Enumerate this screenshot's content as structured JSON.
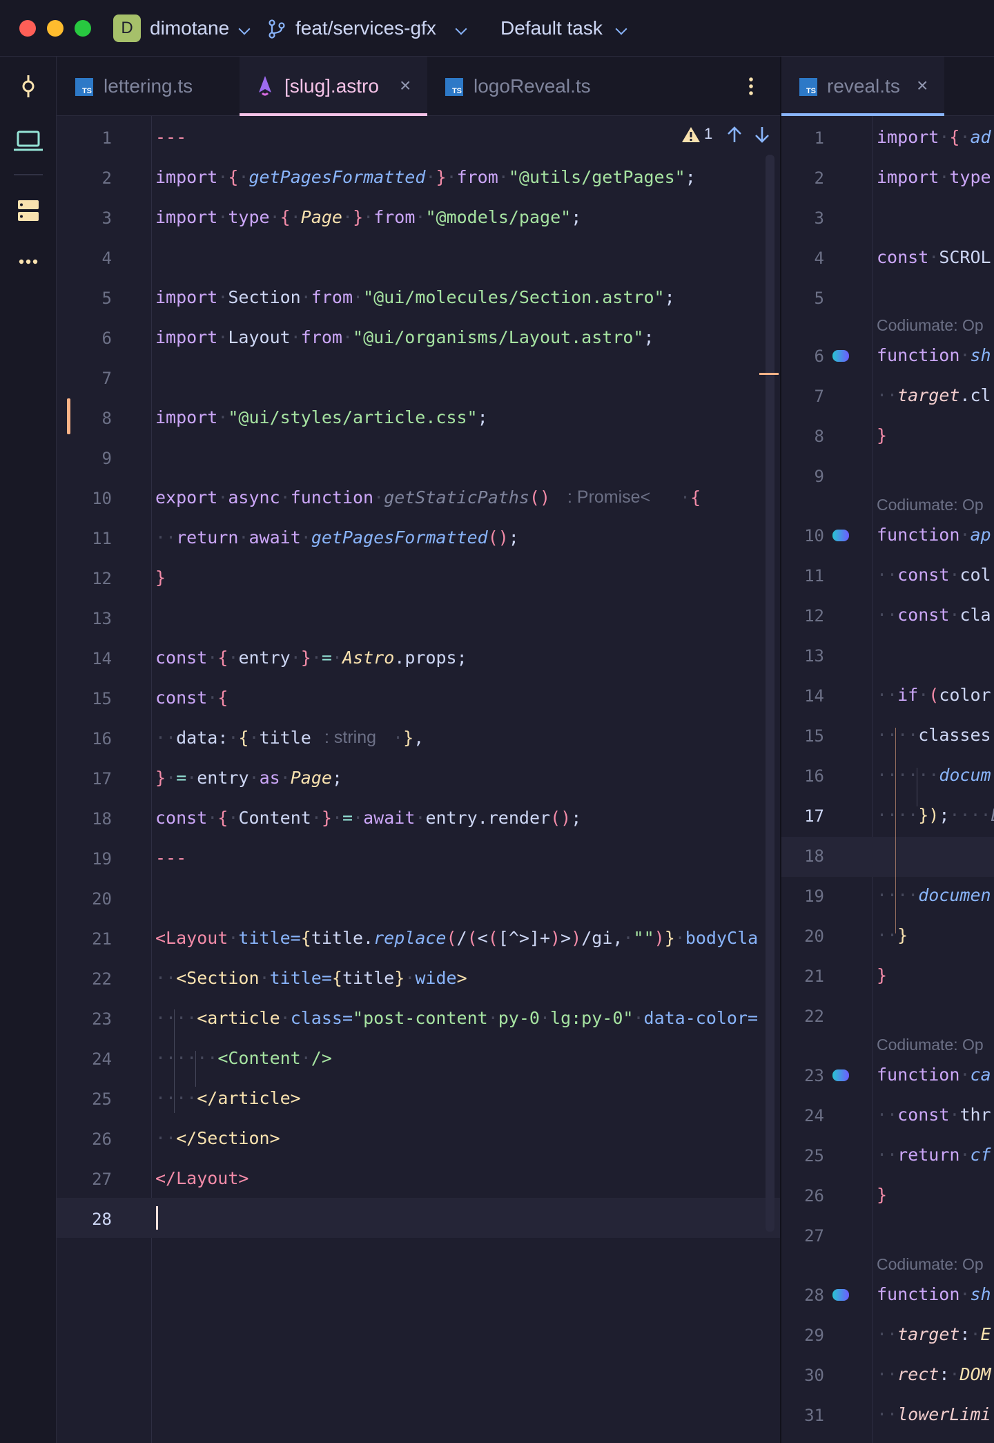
{
  "titlebar": {
    "project_initial": "D",
    "project": "dimotane",
    "branch": "feat/services-gfx",
    "task": "Default task"
  },
  "tabs_left": [
    {
      "label": "lettering.ts"
    },
    {
      "label": "[slug].astro"
    },
    {
      "label": "logoReveal.ts"
    }
  ],
  "tabs_right": [
    {
      "label": "reveal.ts"
    }
  ],
  "inspection": {
    "warnings": "1"
  },
  "hints": {
    "promise": ": Promise<",
    "string": ": string",
    "codiumate": "Codiumate: Op"
  },
  "colors": {
    "background": "#1e1e2e",
    "accent_pink": "#f5c2e7",
    "accent_blue": "#89b4fa"
  }
}
